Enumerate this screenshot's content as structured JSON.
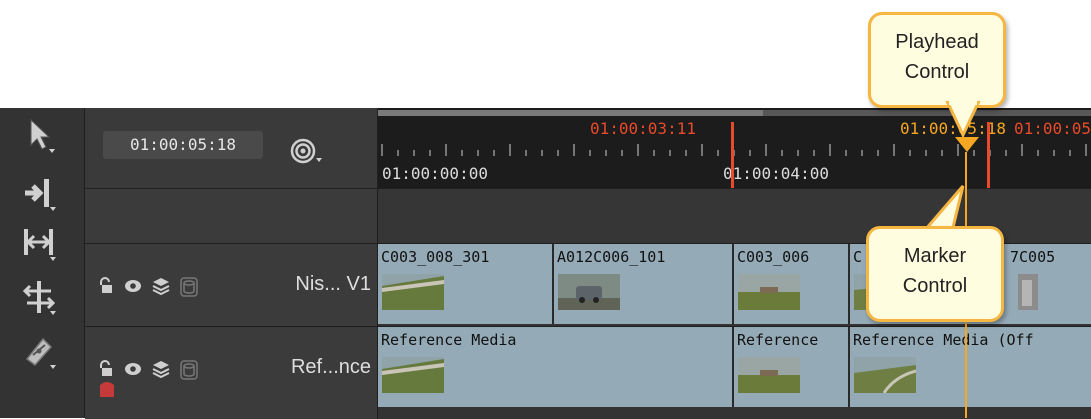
{
  "timeline": {
    "current_timecode": "01:00:05:18",
    "ruler": {
      "in_marker_timecode": "01:00:03:11",
      "playhead_timecode_a": "01:00:05:18",
      "playhead_timecode_b": "01:00:05",
      "major_tick_1": "01:00:00:00",
      "major_tick_2": "01:00:04:00"
    }
  },
  "tools": [
    "pointer-tool",
    "insert-tool",
    "fit-tool",
    "slip-tool",
    "razor-tool"
  ],
  "tracks": [
    {
      "name": "Nis... V1",
      "clips": [
        "C003_008_301",
        "A012C006_101",
        "C003_006",
        "C",
        "7C005"
      ]
    },
    {
      "name": "Ref...nce",
      "clips": [
        "Reference Media",
        "Reference",
        "Reference Media (Off"
      ]
    }
  ],
  "callouts": {
    "playhead": {
      "line1": "Playhead",
      "line2": "Control"
    },
    "marker": {
      "line1": "Marker",
      "line2": "Control"
    }
  },
  "colors": {
    "clip": "#94aab6",
    "in_marker": "#e84a2a",
    "playhead": "#f5a623",
    "callout_border": "#f5b642",
    "callout_fill": "#fffde0"
  }
}
